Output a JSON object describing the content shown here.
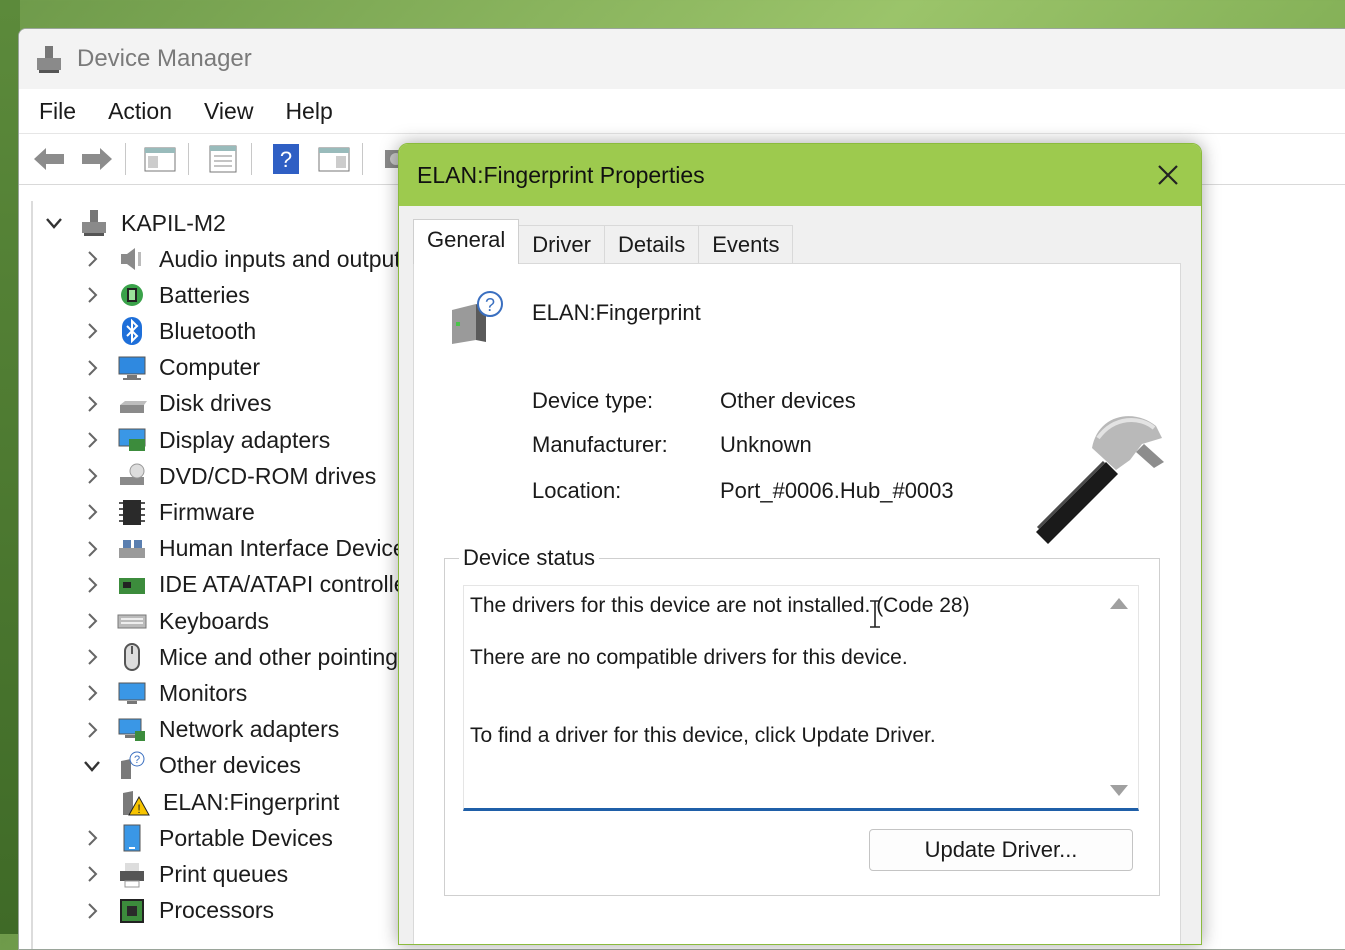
{
  "window": {
    "title": "Device Manager",
    "menu": [
      "File",
      "Action",
      "View",
      "Help"
    ]
  },
  "tree": {
    "root": "KAPIL-M2",
    "items": [
      {
        "label": "Audio inputs and outputs",
        "icon": "speaker-icon",
        "expanded": false
      },
      {
        "label": "Batteries",
        "icon": "battery-icon",
        "expanded": false
      },
      {
        "label": "Bluetooth",
        "icon": "bluetooth-icon",
        "expanded": false
      },
      {
        "label": "Computer",
        "icon": "computer-icon",
        "expanded": false
      },
      {
        "label": "Disk drives",
        "icon": "disk-drive-icon",
        "expanded": false
      },
      {
        "label": "Display adapters",
        "icon": "display-adapter-icon",
        "expanded": false
      },
      {
        "label": "DVD/CD-ROM drives",
        "icon": "dvd-drive-icon",
        "expanded": false
      },
      {
        "label": "Firmware",
        "icon": "firmware-icon",
        "expanded": false
      },
      {
        "label": "Human Interface Devices",
        "icon": "hid-icon",
        "expanded": false
      },
      {
        "label": "IDE ATA/ATAPI controllers",
        "icon": "ide-controller-icon",
        "expanded": false
      },
      {
        "label": "Keyboards",
        "icon": "keyboard-icon",
        "expanded": false
      },
      {
        "label": "Mice and other pointing devices",
        "icon": "mouse-icon",
        "expanded": false
      },
      {
        "label": "Monitors",
        "icon": "monitor-icon",
        "expanded": false
      },
      {
        "label": "Network adapters",
        "icon": "network-adapter-icon",
        "expanded": false
      },
      {
        "label": "Other devices",
        "icon": "unknown-device-icon",
        "expanded": true
      },
      {
        "label": "ELAN:Fingerprint",
        "icon": "warning-device-icon",
        "child": true
      },
      {
        "label": "Portable Devices",
        "icon": "portable-device-icon",
        "expanded": false
      },
      {
        "label": "Print queues",
        "icon": "printer-icon",
        "expanded": false
      },
      {
        "label": "Processors",
        "icon": "processor-icon",
        "expanded": false
      }
    ]
  },
  "dialog": {
    "title": "ELAN:Fingerprint Properties",
    "tabs": [
      "General",
      "Driver",
      "Details",
      "Events"
    ],
    "active_tab": "General",
    "device_name": "ELAN:Fingerprint",
    "device_type_label": "Device type:",
    "device_type_value": "Other devices",
    "manufacturer_label": "Manufacturer:",
    "manufacturer_value": "Unknown",
    "location_label": "Location:",
    "location_value": "Port_#0006.Hub_#0003",
    "status_group_title": "Device status",
    "status_line1": "The drivers for this device are not installed. (Code 28)",
    "status_line2": "There are no compatible drivers for this device.",
    "status_line3": "To find a driver for this device, click Update Driver.",
    "update_button": "Update Driver..."
  },
  "colors": {
    "dialog_titlebar": "#9dca4e",
    "status_underline": "#1f5fa8",
    "bluetooth": "#1e6fd9"
  }
}
